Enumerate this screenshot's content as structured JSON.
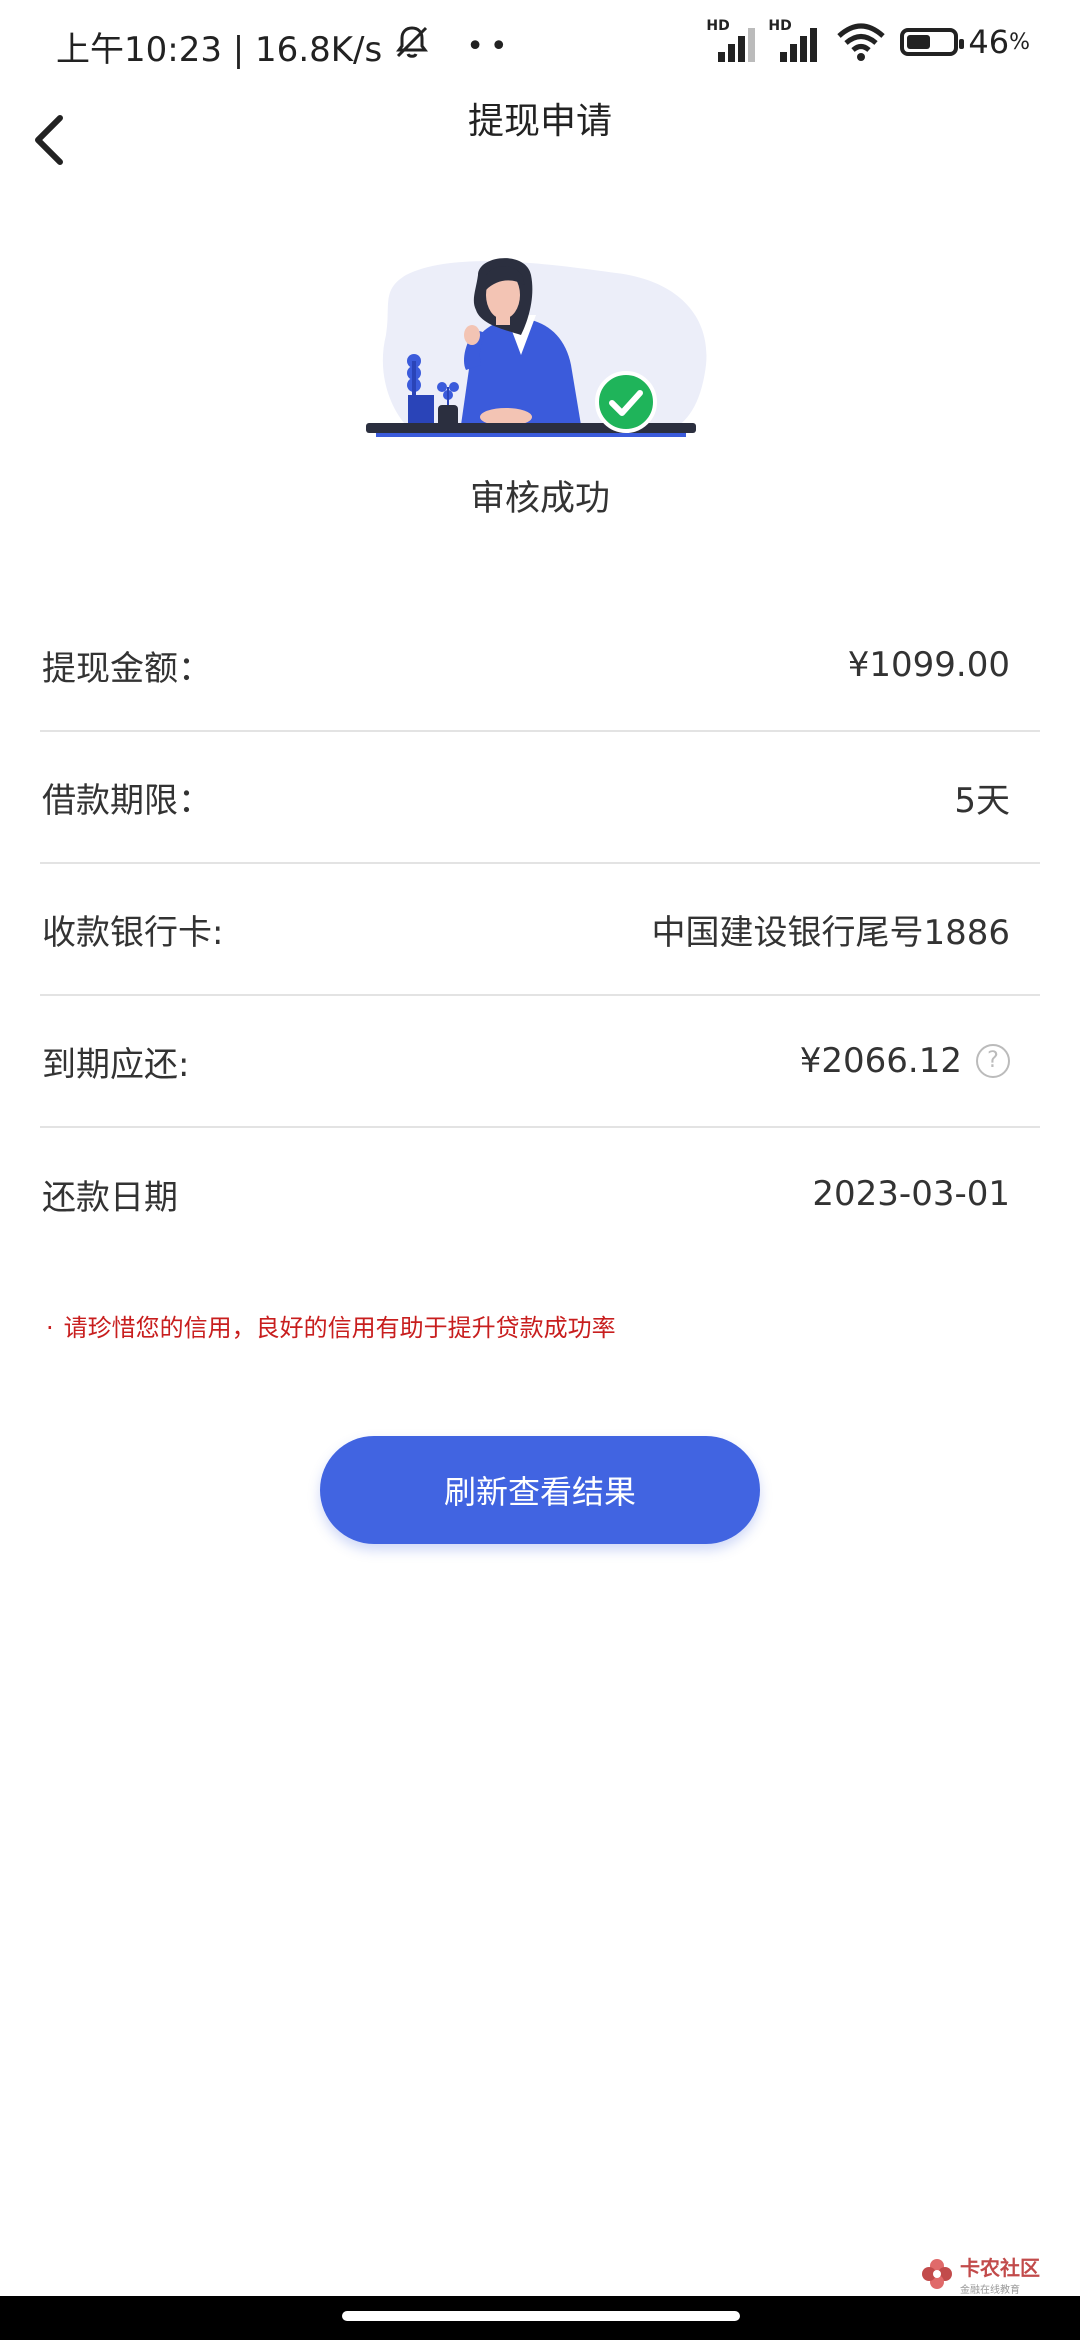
{
  "status_bar": {
    "time_speed": "上午10:23 | 16.8K/s",
    "signal1_label": "HD",
    "signal2_label": "HD",
    "battery_percent": "46",
    "battery_unit": "%"
  },
  "nav": {
    "title": "提现申请"
  },
  "status": {
    "text": "审核成功"
  },
  "rows": [
    {
      "label": "提现金额：",
      "value": "¥1099.00"
    },
    {
      "label": "借款期限：",
      "value": "5天"
    },
    {
      "label": "收款银行卡:",
      "value": "中国建设银行尾号1886"
    },
    {
      "label": "到期应还:",
      "value": "¥2066.12",
      "help": "?"
    },
    {
      "label": "还款日期",
      "value": "2023-03-01"
    }
  ],
  "notice": {
    "bullet": "·",
    "text": "请珍惜您的信用，良好的信用有助于提升贷款成功率"
  },
  "button": {
    "refresh_label": "刷新查看结果"
  },
  "watermark": {
    "title": "卡农社区",
    "subtitle": "金融在线教育"
  },
  "colors": {
    "primary": "#4164e1",
    "notice": "#c81e1e",
    "success": "#1fb45a"
  }
}
